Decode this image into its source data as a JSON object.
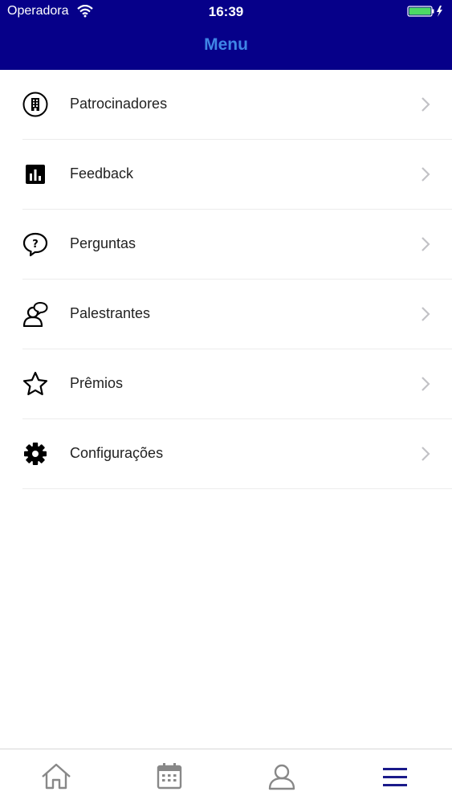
{
  "status_bar": {
    "carrier": "Operadora",
    "time": "16:39"
  },
  "nav": {
    "title": "Menu"
  },
  "menu": {
    "items": [
      {
        "label": "Patrocinadores",
        "icon": "building-icon"
      },
      {
        "label": "Feedback",
        "icon": "bar-chart-icon"
      },
      {
        "label": "Perguntas",
        "icon": "question-bubble-icon"
      },
      {
        "label": "Palestrantes",
        "icon": "speaker-icon"
      },
      {
        "label": "Prêmios",
        "icon": "star-icon"
      },
      {
        "label": "Configurações",
        "icon": "gear-icon"
      }
    ]
  },
  "tab_bar": {
    "items": [
      {
        "icon": "home-icon",
        "selected": false
      },
      {
        "icon": "calendar-icon",
        "selected": false
      },
      {
        "icon": "profile-icon",
        "selected": false
      },
      {
        "icon": "hamburger-menu-icon",
        "selected": true
      }
    ]
  },
  "colors": {
    "header": "#060089",
    "title": "#3f86e6",
    "tab_active": "#1a1a8a",
    "tab_inactive": "#888888",
    "battery": "#4cd964"
  }
}
